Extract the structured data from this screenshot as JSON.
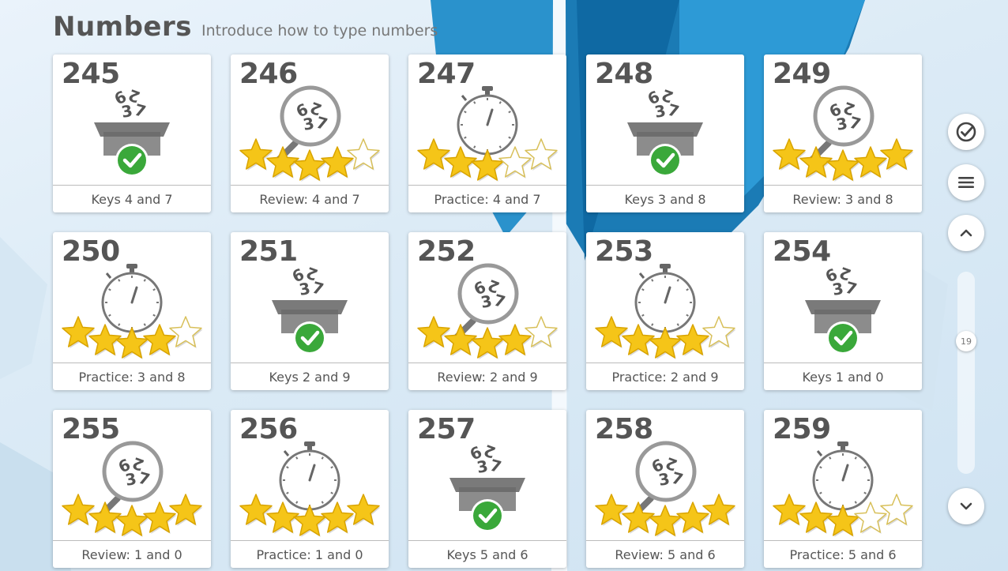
{
  "header": {
    "title": "Numbers",
    "subtitle": "Introduce how to type numbers"
  },
  "lessons": [
    {
      "number": "245",
      "label": "Keys 4 and 7",
      "type": "keys",
      "stars": 0,
      "done": true
    },
    {
      "number": "246",
      "label": "Review: 4 and 7",
      "type": "review",
      "stars": 4
    },
    {
      "number": "247",
      "label": "Practice: 4 and 7",
      "type": "practice",
      "stars": 3
    },
    {
      "number": "248",
      "label": "Keys 3 and 8",
      "type": "keys",
      "stars": 0,
      "done": true
    },
    {
      "number": "249",
      "label": "Review: 3 and 8",
      "type": "review",
      "stars": 5
    },
    {
      "number": "250",
      "label": "Practice: 3 and 8",
      "type": "practice",
      "stars": 4
    },
    {
      "number": "251",
      "label": "Keys 2 and 9",
      "type": "keys",
      "stars": 0,
      "done": true
    },
    {
      "number": "252",
      "label": "Review: 2 and 9",
      "type": "review",
      "stars": 4
    },
    {
      "number": "253",
      "label": "Practice: 2 and 9",
      "type": "practice",
      "stars": 4
    },
    {
      "number": "254",
      "label": "Keys 1 and 0",
      "type": "keys",
      "stars": 0,
      "done": true
    },
    {
      "number": "255",
      "label": "Review: 1 and 0",
      "type": "review",
      "stars": 5
    },
    {
      "number": "256",
      "label": "Practice: 1 and 0",
      "type": "practice",
      "stars": 5
    },
    {
      "number": "257",
      "label": "Keys 5 and 6",
      "type": "keys",
      "stars": 0,
      "done": true
    },
    {
      "number": "258",
      "label": "Review: 5 and 6",
      "type": "review",
      "stars": 5
    },
    {
      "number": "259",
      "label": "Practice: 5 and 6",
      "type": "practice",
      "stars": 3
    }
  ],
  "sidebar": {
    "buttons": [
      {
        "name": "progress-check-button",
        "icon": "check-circle-icon"
      },
      {
        "name": "menu-button",
        "icon": "hamburger-menu-icon"
      },
      {
        "name": "scroll-up-button",
        "icon": "chevron-up-icon"
      },
      {
        "name": "scroll-down-button",
        "icon": "chevron-down-icon"
      }
    ],
    "scroll_value": "19"
  },
  "colors": {
    "accent": "#555555",
    "check_green": "#3aa83a",
    "star_gold": "#f5c518",
    "bg_blue": "#1f7fb8"
  }
}
